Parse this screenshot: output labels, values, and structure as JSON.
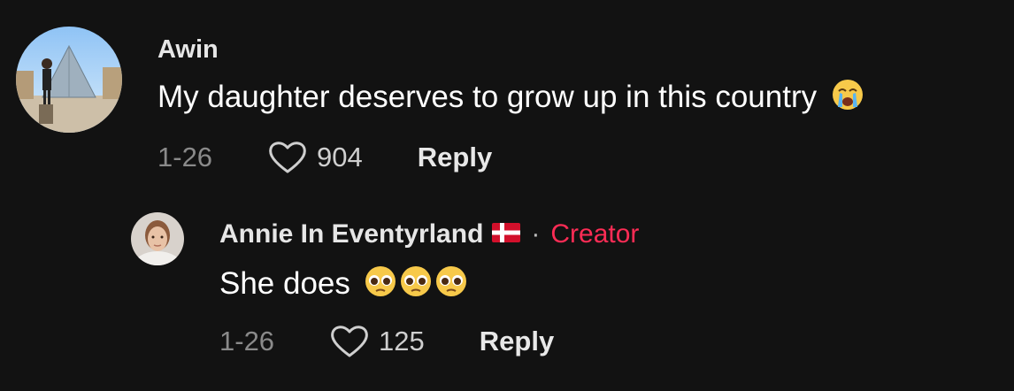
{
  "comment": {
    "username": "Awin",
    "text": "My daughter deserves to grow up in this country",
    "emoji": "loudly-crying-face-emoji",
    "date": "1-26",
    "likes": "904",
    "reply_label": "Reply"
  },
  "reply": {
    "username": "Annie In Eventyrland",
    "flag": "denmark-flag-emoji",
    "separator": "·",
    "badge": "Creator",
    "text": "She does",
    "emoji": "pleading-face-emoji",
    "date": "1-26",
    "likes": "125",
    "reply_label": "Reply"
  },
  "colors": {
    "background": "#121212",
    "creator": "#fe2c55",
    "muted": "#8a8a8a"
  }
}
